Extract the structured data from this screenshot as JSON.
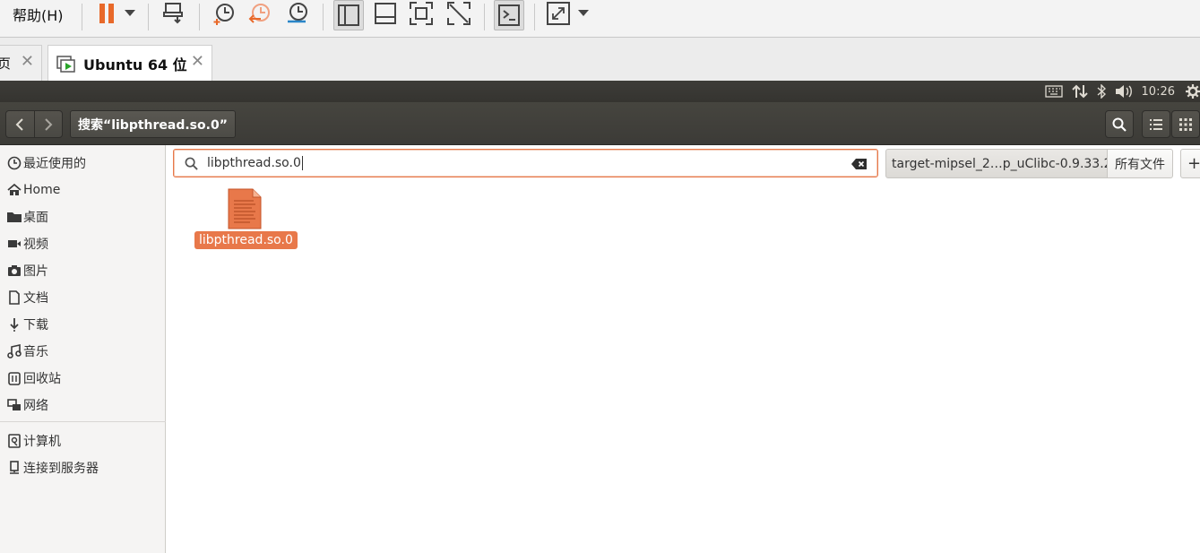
{
  "vm_toolbar": {
    "help_menu": "帮助(H)",
    "icons": [
      "pause-icon",
      "dropdown-arrow-icon",
      "send-ctrl-alt-del-icon",
      "snapshot-take-icon",
      "snapshot-revert-icon",
      "snapshot-manager-icon",
      "library-view-icon",
      "thumbnail-bar-icon",
      "fullscreen-icon",
      "unity-icon",
      "console-icon",
      "stretch-view-icon",
      "dropdown-arrow-icon"
    ]
  },
  "vm_tabs": [
    {
      "label": "页",
      "active": false
    },
    {
      "label": "Ubuntu 64 位",
      "active": true
    }
  ],
  "ubuntu_topbar": {
    "time": "10:26",
    "indicators": [
      "keyboard-icon",
      "network-icon",
      "bluetooth-icon",
      "volume-icon",
      "settings-gear-icon"
    ]
  },
  "nautilus": {
    "path_title": "搜索“libpthread.so.0”",
    "search": {
      "value": "libpthread.so.0"
    },
    "location_filter": "target-mipsel_2…p_uClibc-0.9.33.2",
    "type_filter": "所有文件",
    "add_button": "+"
  },
  "sidebar": {
    "items": [
      {
        "label": "最近使用的",
        "icon": "recent-clock-icon"
      },
      {
        "label": "Home",
        "icon": "home-icon"
      },
      {
        "label": "桌面",
        "icon": "desktop-folder-icon"
      },
      {
        "label": "视频",
        "icon": "video-icon"
      },
      {
        "label": "图片",
        "icon": "camera-icon"
      },
      {
        "label": "文档",
        "icon": "document-icon"
      },
      {
        "label": "下载",
        "icon": "download-icon"
      },
      {
        "label": "音乐",
        "icon": "music-icon"
      },
      {
        "label": "回收站",
        "icon": "trash-icon"
      },
      {
        "label": "网络",
        "icon": "network-icon"
      }
    ],
    "devices": [
      {
        "label": "计算机",
        "icon": "computer-icon"
      },
      {
        "label": "连接到服务器",
        "icon": "server-icon"
      }
    ]
  },
  "results": [
    {
      "name": "libpthread.so.0",
      "icon": "text-file-icon",
      "selected": true
    }
  ],
  "colors": {
    "accent": "#e8784a",
    "topbar": "#3c3b37",
    "sidebar": "#f5f4f3"
  }
}
